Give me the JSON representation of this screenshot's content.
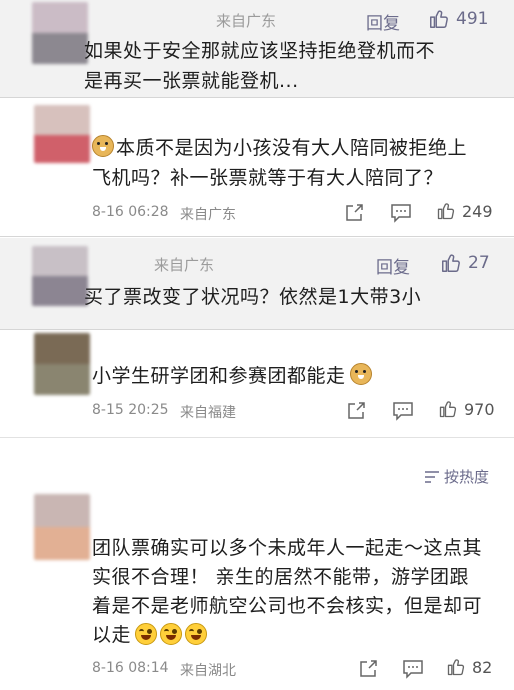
{
  "comments": [
    {
      "source": "来自广东",
      "reply_label": "回复",
      "like_count": "491",
      "text_lines": [
        "如果处于安全那就应该坚持拒绝登机而不",
        "是再买一张票就能登机..."
      ]
    },
    {
      "text_lines": [
        "本质不是因为小孩没有大人陪同被拒绝上",
        "飞机吗？补一张票就等于有大人陪同了？"
      ],
      "date": "8-16 06:28",
      "source": "来自广东",
      "like_count": "249"
    },
    {
      "source": "来自广东",
      "reply_label": "回复",
      "like_count": "27",
      "text_lines": [
        "买了票改变了状况吗？依然是1大带3小"
      ]
    },
    {
      "text_lines": [
        "小学生研学团和参赛团都能走"
      ],
      "date": "8-15 20:25",
      "source": "来自福建",
      "like_count": "970"
    },
    {
      "sort_label": "按热度",
      "text_lines": [
        "团队票确实可以多个未成年人一起走～这点其",
        "实很不合理！  亲生的居然不能带，游学团跟",
        "着是不是老师航空公司也不会核实，但是却可",
        "以走"
      ],
      "date": "8-16 08:14",
      "source": "来自湖北",
      "like_count": "82"
    }
  ],
  "icons": {
    "like": "thumbs-up-icon",
    "share": "share-icon",
    "comment": "comment-icon",
    "sort": "sort-icon",
    "doge": "doge-emoji",
    "cry": "crying-laughing-emoji"
  }
}
